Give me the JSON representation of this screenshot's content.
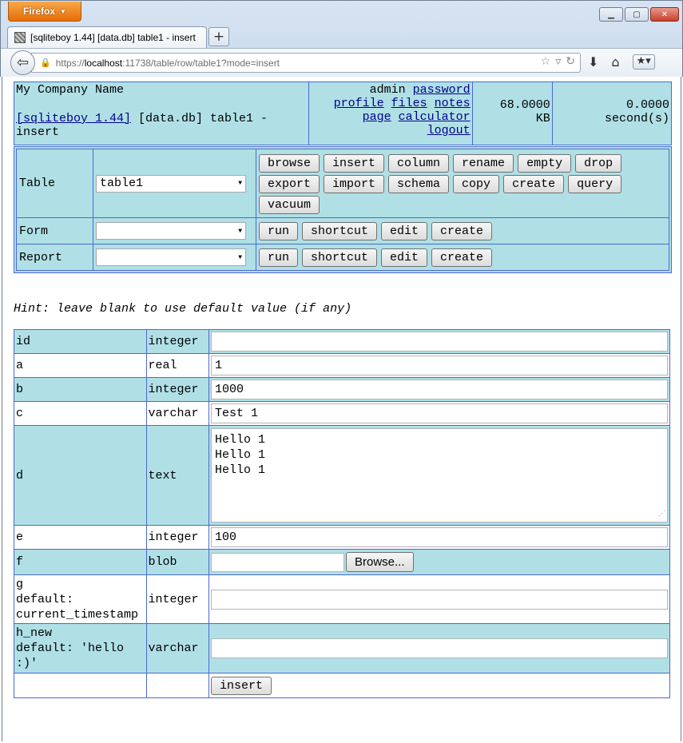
{
  "browser": {
    "menu_label": "Firefox",
    "tab_title": "[sqliteboy 1.44] [data.db] table1 - insert",
    "url_scheme": "https://",
    "url_host": "localhost",
    "url_rest": ":11738/table/row/table1?mode=insert",
    "icons": [
      "back-arrow-icon",
      "lock-icon",
      "star-icon",
      "refresh-icon",
      "download-icon",
      "home-icon",
      "bookmarks-icon"
    ]
  },
  "header": {
    "company": "My Company Name",
    "app_link": "[sqliteboy 1.44]",
    "context": " [data.db] table1 - insert",
    "user": "admin",
    "links": {
      "password": "password",
      "profile": "profile",
      "files": "files",
      "notes": "notes",
      "page": "page",
      "calculator": "calculator",
      "logout": "logout"
    },
    "size_value": "68.0000",
    "size_unit": "KB",
    "time_value": "0.0000",
    "time_unit": "second(s)"
  },
  "nav": {
    "table_label": "Table",
    "table_selected": "table1",
    "table_buttons": [
      "browse",
      "insert",
      "column",
      "rename",
      "empty",
      "drop",
      "export",
      "import",
      "schema",
      "copy",
      "create",
      "query",
      "vacuum"
    ],
    "form_label": "Form",
    "form_selected": "",
    "report_label": "Report",
    "report_selected": "",
    "action_buttons": [
      "run",
      "shortcut",
      "edit",
      "create"
    ]
  },
  "hint": "Hint: leave blank to use default value (if any)",
  "rows": [
    {
      "name": "id",
      "type": "integer",
      "value": ""
    },
    {
      "name": "a",
      "type": "real",
      "value": "1"
    },
    {
      "name": "b",
      "type": "integer",
      "value": "1000"
    },
    {
      "name": "c",
      "type": "varchar",
      "value": "Test 1"
    },
    {
      "name": "d",
      "type": "text",
      "value": "Hello 1\nHello 1\nHello 1"
    },
    {
      "name": "e",
      "type": "integer",
      "value": "100"
    },
    {
      "name": "f",
      "type": "blob",
      "value": ""
    },
    {
      "name": "g\ndefault:\ncurrent_timestamp",
      "type": "integer",
      "value": ""
    },
    {
      "name": "h_new\ndefault: 'hello\n:)'",
      "type": "varchar",
      "value": ""
    }
  ],
  "browse_label": "Browse...",
  "submit_label": "insert",
  "colors": {
    "cell_bg": "#b0e0e6",
    "border": "#4a6ad1",
    "link": "#00008b"
  }
}
